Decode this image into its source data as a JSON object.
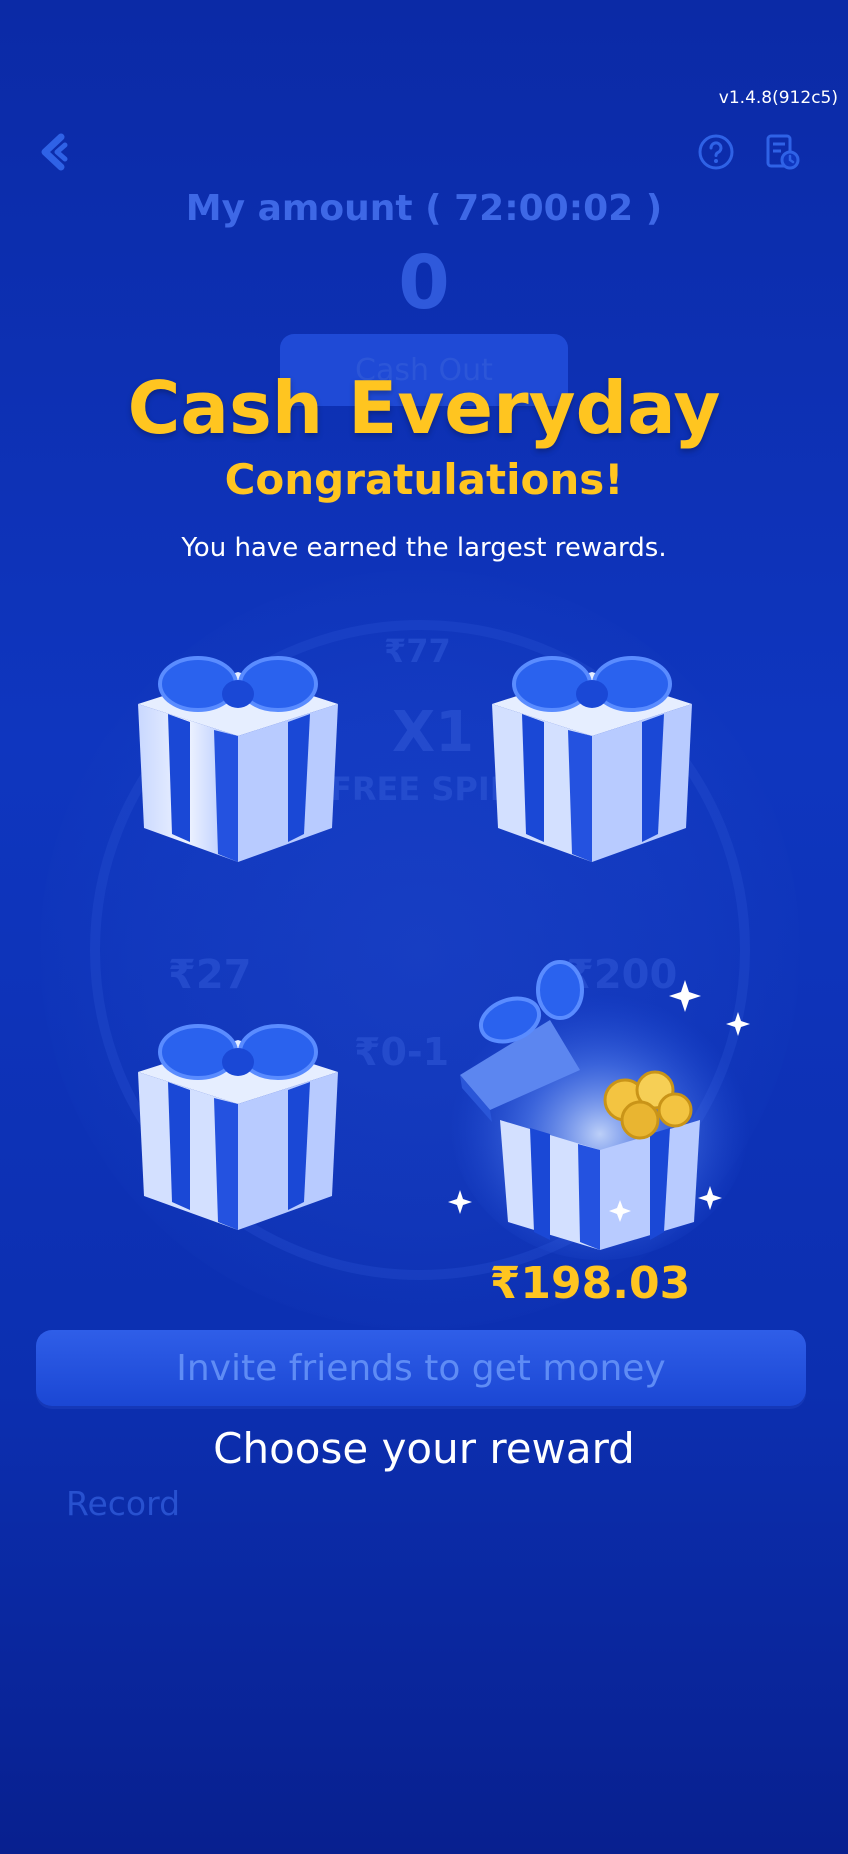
{
  "version": "v1.4.8(912c5)",
  "header": {
    "my_amount_label": "My amount ( 72:00:02 )",
    "amount_value": "0",
    "cash_out_label": "Cash Out",
    "record_label": "Record"
  },
  "wheel_labels": [
    "₹77",
    "X1",
    "FREE SPIN",
    "₹27",
    "₹200",
    "₹0-1"
  ],
  "overlay": {
    "title": "Cash Everyday",
    "subtitle": "Congratulations!",
    "description": "You have earned the largest rewards.",
    "prize_amount": "₹198.03",
    "invite_button": "Invite friends to get money",
    "choose_text": "Choose your reward"
  },
  "colors": {
    "background": "#0f36bf",
    "accent_gold": "#ffc520",
    "button_blue": "#2f5ee8"
  },
  "icons": [
    "back-arrow-icon",
    "help-icon",
    "record-document-icon"
  ]
}
